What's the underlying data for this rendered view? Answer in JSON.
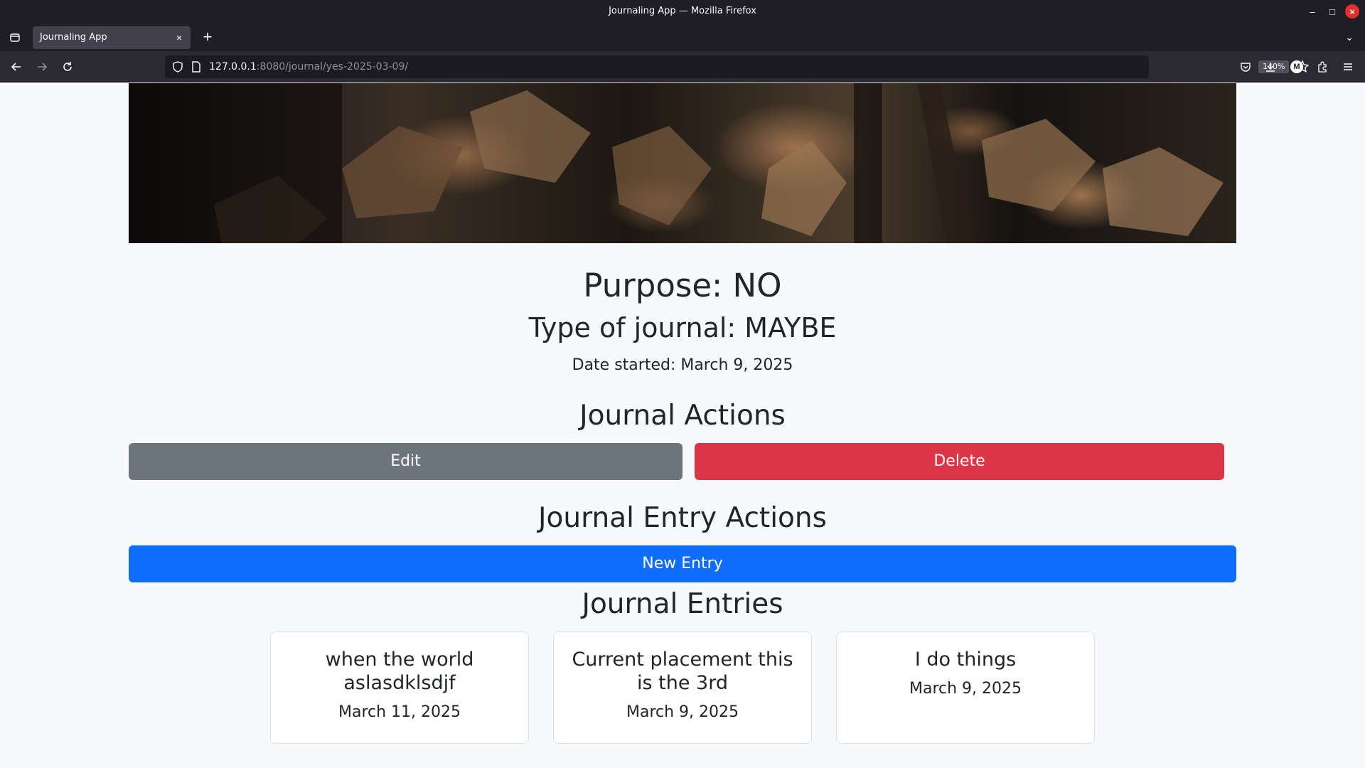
{
  "window": {
    "title": "Journaling App — Mozilla Firefox"
  },
  "tabs": [
    {
      "label": "Journaling App"
    }
  ],
  "urlbar": {
    "host": "127.0.0.1",
    "rest": ":8080/journal/yes-2025-03-09/",
    "zoom": "140%"
  },
  "icons": {
    "back": "arrow-left",
    "forward": "arrow-right",
    "reload": "reload",
    "pocket": "pocket",
    "downloads": "download",
    "account": "M",
    "extensions": "puzzle",
    "menu": "hamburger"
  },
  "journal": {
    "purpose": "Purpose: NO",
    "type": "Type of journal: MAYBE",
    "date_started": "Date started: March 9, 2025"
  },
  "actions": {
    "heading": "Journal Actions",
    "edit_label": "Edit",
    "delete_label": "Delete"
  },
  "entry_actions": {
    "heading": "Journal Entry Actions",
    "new_entry_label": "New Entry"
  },
  "entries": {
    "heading": "Journal Entries",
    "items": [
      {
        "title": "when the world aslasdklsdjf",
        "date": "March 11, 2025"
      },
      {
        "title": "Current placement this is the 3rd",
        "date": "March 9, 2025"
      },
      {
        "title": "I do things",
        "date": "March 9, 2025"
      }
    ]
  },
  "colors": {
    "edit": "#6c757d",
    "delete": "#dc3545",
    "primary": "#0d6efd",
    "page_bg": "#f8f9fa"
  }
}
